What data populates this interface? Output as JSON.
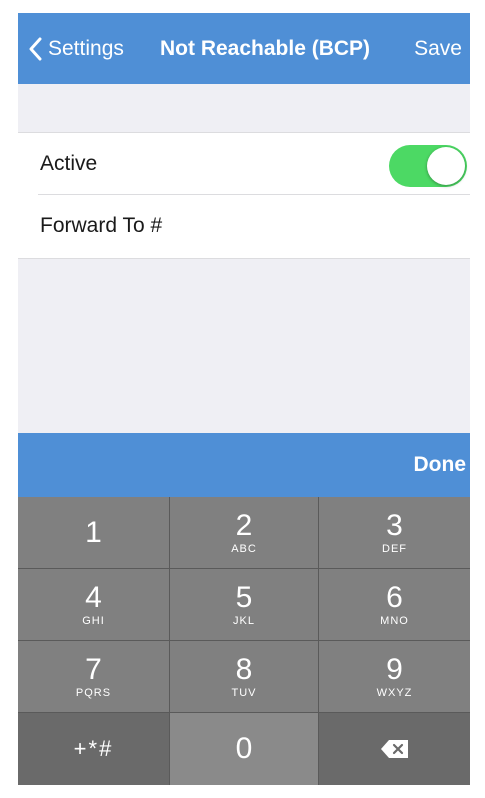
{
  "navbar": {
    "back_label": "Settings",
    "title": "Not Reachable (BCP)",
    "save_label": "Save"
  },
  "form": {
    "active_label": "Active",
    "active_on": true,
    "forward_label": "Forward To #",
    "forward_value": ""
  },
  "keyboard": {
    "done_label": "Done",
    "keys": [
      {
        "digit": "1",
        "letters": ""
      },
      {
        "digit": "2",
        "letters": "ABC"
      },
      {
        "digit": "3",
        "letters": "DEF"
      },
      {
        "digit": "4",
        "letters": "GHI"
      },
      {
        "digit": "5",
        "letters": "JKL"
      },
      {
        "digit": "6",
        "letters": "MNO"
      },
      {
        "digit": "7",
        "letters": "PQRS"
      },
      {
        "digit": "8",
        "letters": "TUV"
      },
      {
        "digit": "9",
        "letters": "WXYZ"
      }
    ],
    "symbols_label": "+*#",
    "zero_label": "0",
    "delete_icon": "backspace-icon"
  },
  "colors": {
    "accent": "#4f8fd6",
    "toggle_on": "#4cd964",
    "key_bg": "#808080",
    "key_dark_bg": "#6a6a6a"
  }
}
